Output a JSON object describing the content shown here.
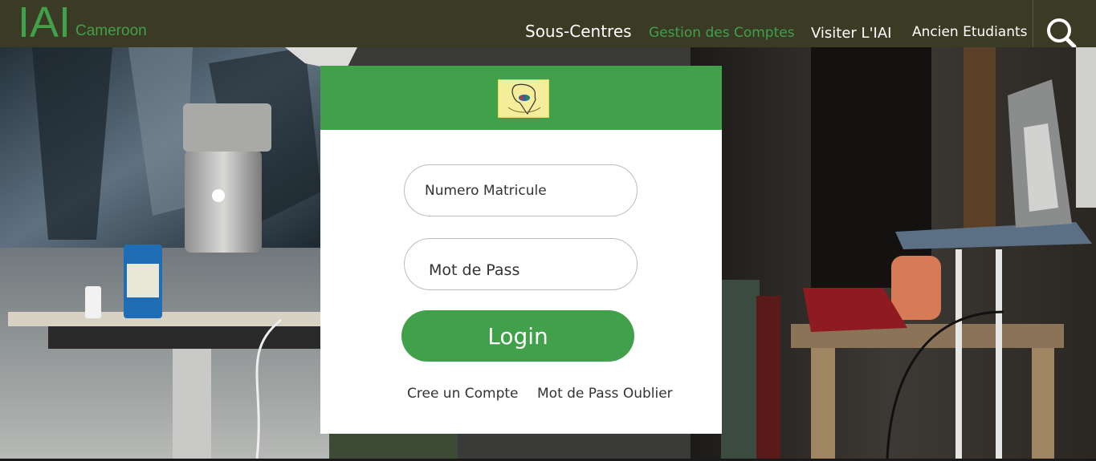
{
  "brand": {
    "main": "IAI",
    "sub": "Cameroon"
  },
  "nav": {
    "items": [
      {
        "label": "Sous-Centres"
      },
      {
        "label": "Gestion des Comptes"
      },
      {
        "label": "Visiter L'IAI"
      },
      {
        "label": "Ancien Etudiants"
      }
    ],
    "search_icon": "search-icon"
  },
  "login": {
    "matricule_placeholder": "Numero Matricule",
    "password_placeholder": "Mot de Pass",
    "submit_label": "Login",
    "create_account_label": "Cree un Compte",
    "forgot_password_label": "Mot de Pass Oublier",
    "logo_icon": "africa-map-logo-icon"
  },
  "colors": {
    "accent_green": "#41a04a",
    "header_bg": "#3b3a24",
    "card_bg": "#ffffff"
  }
}
